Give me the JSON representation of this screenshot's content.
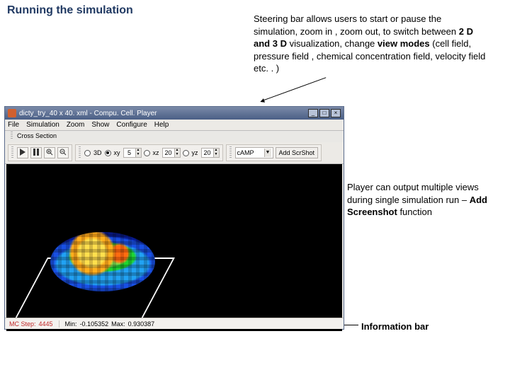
{
  "slide": {
    "title": "Running the simulation",
    "desc_top_1": "Steering bar allows users to start or pause the simulation, zoom in , zoom out, to switch between",
    "desc_top_bold1": "2 D and 3 D",
    "desc_top_2": " visualization, change ",
    "desc_top_bold2": "view modes",
    "desc_top_3": " (cell field, pressure field , chemical concentration field, velocity field etc. . )",
    "desc_right_1": "Player can output multiple views during single simulation run – ",
    "desc_right_bold": "Add Screenshot",
    "desc_right_2": " function",
    "desc_bottom": "Information bar"
  },
  "window": {
    "title": "dicty_try_40 x 40. xml - Compu. Cell. Player",
    "min": "_",
    "max": "□",
    "close": "×"
  },
  "menu": {
    "file": "File",
    "simulation": "Simulation",
    "zoom": "Zoom",
    "show": "Show",
    "configure": "Configure",
    "help": "Help"
  },
  "toolbar": {
    "cross_section": "Cross Section",
    "threeD": "3D",
    "xy": "xy",
    "xz": "xz",
    "yz": "yz",
    "xy_val": "5",
    "xz_val": "20",
    "yz_val": "20",
    "field_value": "cAMP",
    "add_scr": "Add ScrShot"
  },
  "status": {
    "mcstep_label": "MC Step:",
    "mcstep_val": "4445",
    "min_label": "Min:",
    "min_val": "-0.105352",
    "max_label": "Max:",
    "max_val": "0.930387"
  }
}
